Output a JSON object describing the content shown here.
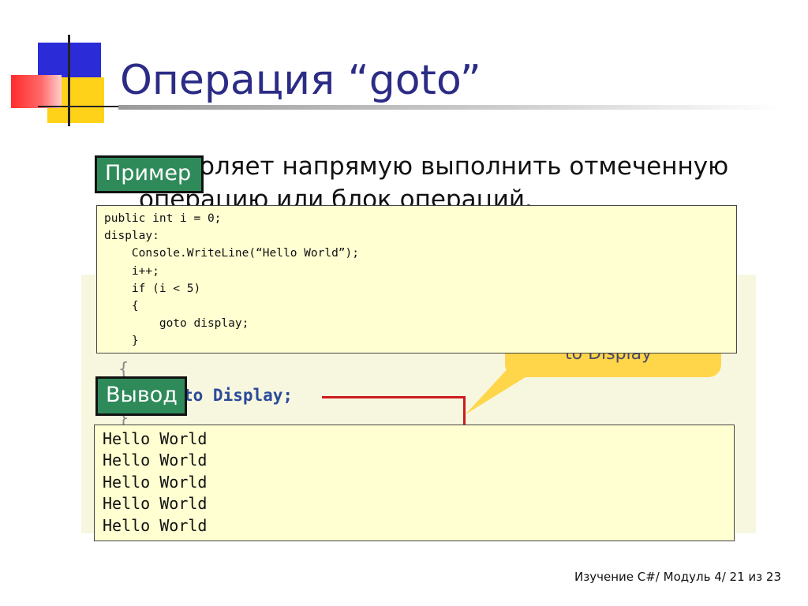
{
  "slide": {
    "title": "Операция “goto”",
    "bullet_visible_text": "Позволяет напрямую выполнить отмеченную операцию или блок операций."
  },
  "labels": {
    "example": "Пример",
    "output": "Вывод"
  },
  "code_lines": [
    "public int i = 0;",
    "display:",
    "    Console.WriteLine(“Hello World”);",
    "    i++;",
    "    if (i < 5)",
    "    {",
    "        goto display;",
    "    }"
  ],
  "output_lines": [
    "Hello World",
    "Hello World",
    "Hello World",
    "Hello World",
    "Hello World"
  ],
  "background_image": {
    "brace_open": "{",
    "code_fragment": "to Display;",
    "brace_close": "}",
    "bubble_text": "to Display"
  },
  "footer": "Изучение C#/ Модуль 4/ 21 из 23",
  "colors": {
    "title": "#2c2c86",
    "label_bg": "#2f8a5a",
    "box_bg": "#ffffd2",
    "logo_blue": "#2b2bd8",
    "logo_yellow": "#ffd21a",
    "logo_red": "#ff2b2b"
  }
}
